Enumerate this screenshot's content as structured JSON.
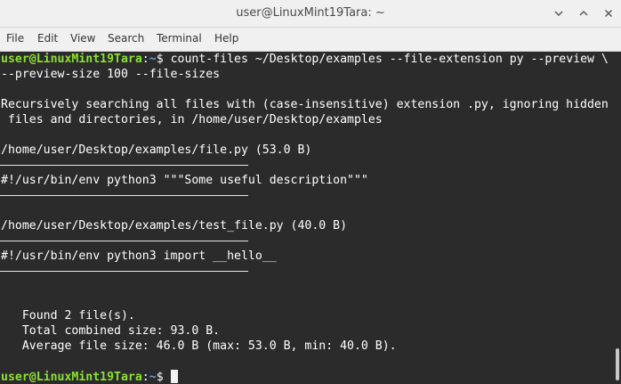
{
  "window": {
    "title": "user@LinuxMint19Tara: ~",
    "minimize_icon": "minimize-icon",
    "maximize_icon": "maximize-icon",
    "close_icon": "close-icon"
  },
  "menu": {
    "file": "File",
    "edit": "Edit",
    "view": "View",
    "search": "Search",
    "terminal": "Terminal",
    "help": "Help"
  },
  "colors": {
    "prompt_user": "#8ae234",
    "prompt_path": "#729fcf",
    "background": "#2b2b2b",
    "text": "#ffffff"
  },
  "terminal": {
    "prompt_user": "user@LinuxMint19Tara",
    "prompt_colon": ":",
    "prompt_path": "~",
    "prompt_symbol": "$ ",
    "command_part1": "count-files ~/Desktop/examples --file-extension py --preview \\",
    "command_part2": "--preview-size 100 --file-sizes",
    "info_line1": "Recursively searching all files with (case-insensitive) extension .py, ignoring hidden",
    "info_line2": " files and directories, in /home/user/Desktop/examples",
    "file1_header": "/home/user/Desktop/examples/file.py (53.0 B)",
    "file1_preview": "#!/usr/bin/env python3 \"\"\"Some useful description\"\"\"",
    "file2_header": "/home/user/Desktop/examples/test_file.py (40.0 B)",
    "file2_preview": "#!/usr/bin/env python3 import __hello__",
    "summary_found": "   Found 2 file(s).",
    "summary_total": "   Total combined size: 93.0 B.",
    "summary_average": "   Average file size: 46.0 B (max: 53.0 B, min: 40.0 B)."
  }
}
